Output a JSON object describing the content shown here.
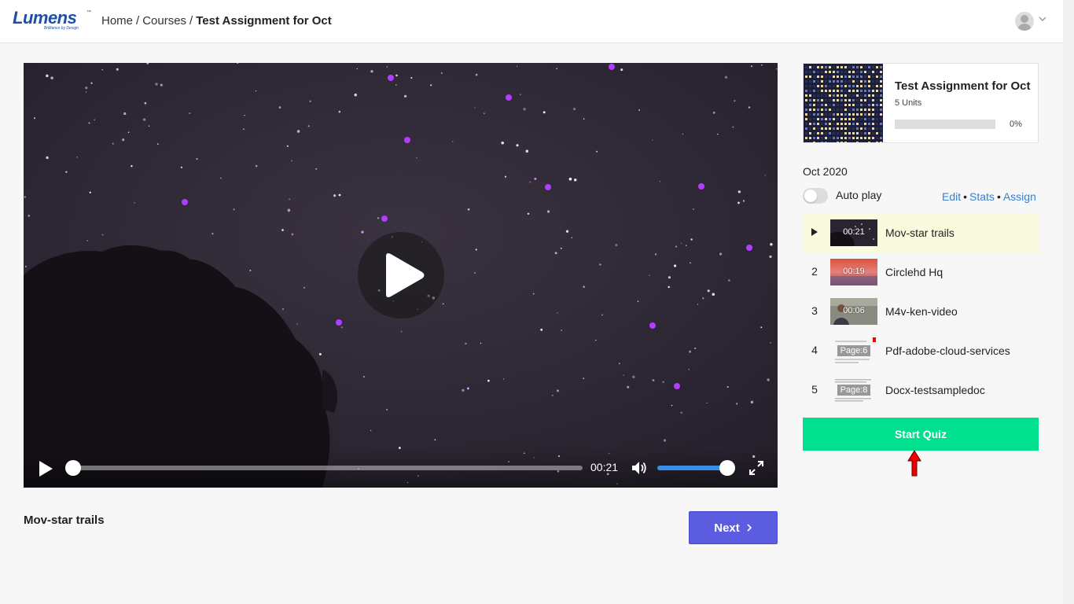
{
  "header": {
    "logo_text": "Lumens",
    "logo_tagline": "Brilliance by Design",
    "breadcrumb": {
      "home": "Home",
      "sep1": "/",
      "courses": "Courses",
      "sep2": "/",
      "current": "Test Assignment for Oct"
    }
  },
  "player": {
    "time": "00:21",
    "progress": 0,
    "volume": 1.0,
    "current_title": "Mov-star trails",
    "next_label": "Next"
  },
  "course": {
    "title": "Test Assignment for Oct",
    "units": "5 Units",
    "progress_label": "0%",
    "progress": 0
  },
  "playlist": {
    "date": "Oct 2020",
    "autoplay_label": "Auto play",
    "autoplay_on": false,
    "actions": {
      "edit": "Edit",
      "stats": "Stats",
      "assign": "Assign",
      "dot": "•"
    },
    "units": [
      {
        "num": "",
        "duration": "00:21",
        "name": "Mov-star trails",
        "active": true
      },
      {
        "num": "2",
        "duration": "00:19",
        "name": "Circlehd Hq",
        "active": false
      },
      {
        "num": "3",
        "duration": "00:06",
        "name": "M4v-ken-video",
        "active": false
      },
      {
        "num": "4",
        "page": "Page:6",
        "name": "Pdf-adobe-cloud-services",
        "active": false
      },
      {
        "num": "5",
        "page": "Page:8",
        "name": "Docx-testsampledoc",
        "active": false
      }
    ],
    "quiz_label": "Start Quiz"
  },
  "colors": {
    "accent_blue": "#3a8ee6",
    "next_button": "#5b5ce0",
    "quiz_button": "#00e08f",
    "active_row": "#fafadf"
  }
}
